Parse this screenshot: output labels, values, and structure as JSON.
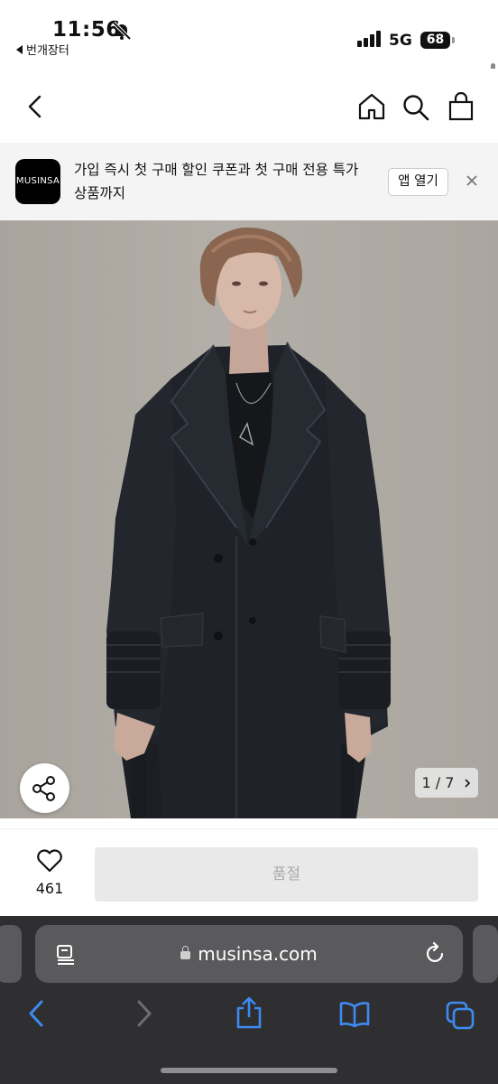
{
  "status_bar": {
    "time": "11:56",
    "back_app": "번개장터",
    "network": "5G",
    "battery": "68"
  },
  "nav": {
    "back_icon": "chevron-left-icon",
    "home_icon": "home-icon",
    "search_icon": "search-icon",
    "bag_icon": "shopping-bag-icon"
  },
  "app_banner": {
    "logo_text": "MUSINSA",
    "message": "가입 즉시 첫 구매 할인 쿠폰과 첫 구매 전용 특가 상품까지",
    "open_button": "앱 열기"
  },
  "gallery": {
    "counter": "1 / 7",
    "accent_coat": "#1f2329",
    "background": "#aeaaa3"
  },
  "actions": {
    "like_count": "461",
    "soldout_label": "품절"
  },
  "safari": {
    "url": "musinsa.com",
    "accent": "#3d8bf2"
  }
}
